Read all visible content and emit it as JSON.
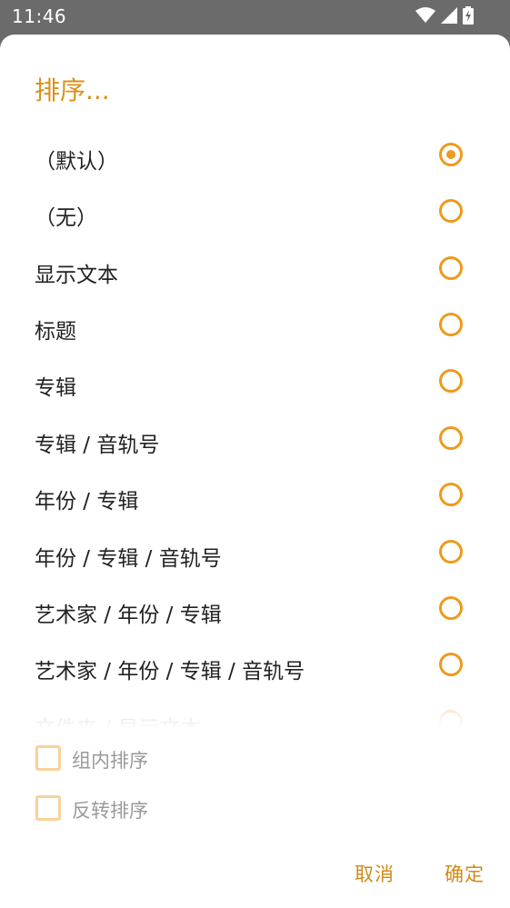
{
  "status_bar": {
    "time": "11:46",
    "icons": [
      "wifi-icon",
      "cellular-signal-icon",
      "battery-charging-icon"
    ]
  },
  "dialog": {
    "title": "排序...",
    "options": [
      {
        "label": "（默认）",
        "selected": true
      },
      {
        "label": "（无）",
        "selected": false
      },
      {
        "label": "显示文本",
        "selected": false
      },
      {
        "label": "标题",
        "selected": false
      },
      {
        "label": "专辑",
        "selected": false
      },
      {
        "label": "专辑 / 音轨号",
        "selected": false
      },
      {
        "label": "年份 / 专辑",
        "selected": false
      },
      {
        "label": "年份 / 专辑 / 音轨号",
        "selected": false
      },
      {
        "label": "艺术家 / 年份 / 专辑",
        "selected": false
      },
      {
        "label": "艺术家 / 年份 / 专辑 / 音轨号",
        "selected": false
      },
      {
        "label": "文件夹 / 显示文本",
        "selected": false
      }
    ],
    "checkboxes": [
      {
        "label": "组内排序",
        "checked": false
      },
      {
        "label": "反转排序",
        "checked": false
      }
    ],
    "buttons": {
      "cancel": "取消",
      "ok": "确定"
    }
  },
  "colors": {
    "accent": "#ef9a1c",
    "title": "#d9901a",
    "status_bar": "#6b6b6b"
  }
}
